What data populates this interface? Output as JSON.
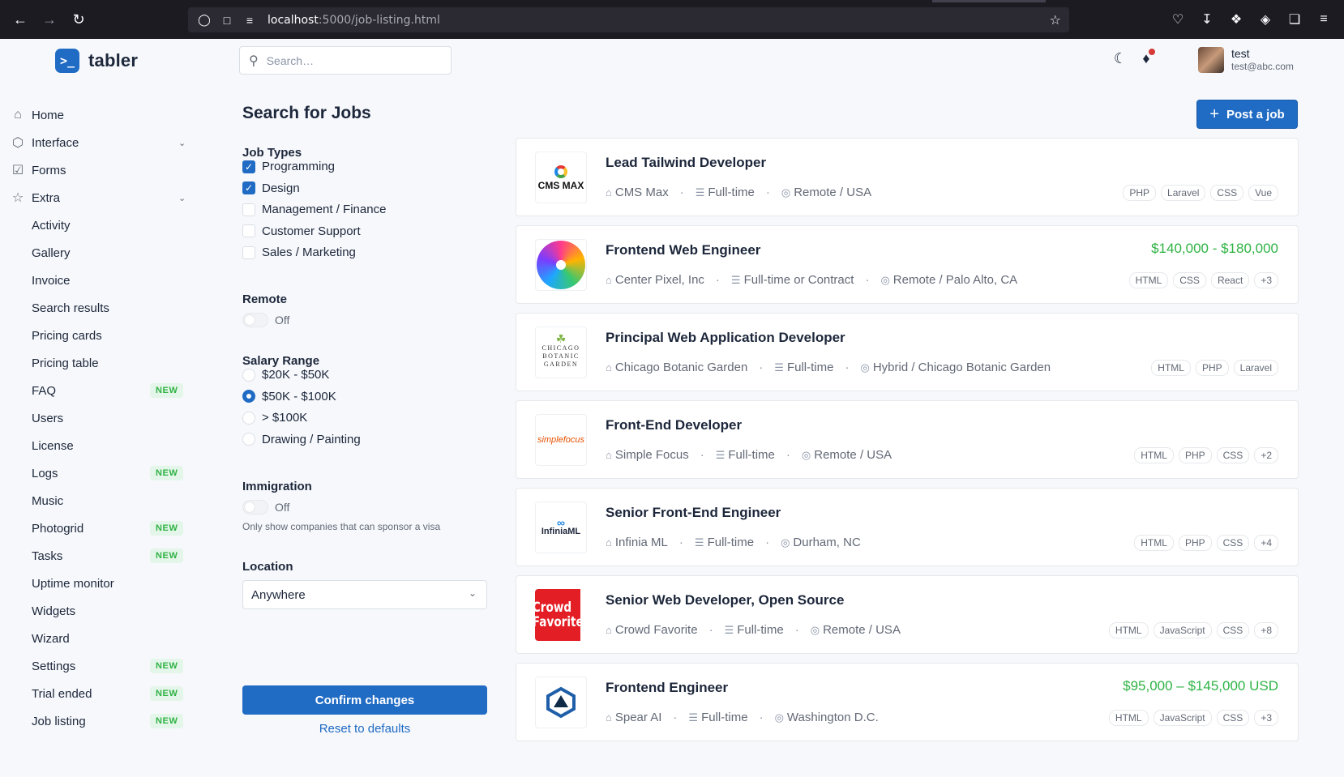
{
  "browser": {
    "url_host": "localhost",
    "url_path": ":5000/job-listing.html"
  },
  "brand": {
    "logo_glyph": ">_",
    "name": "tabler"
  },
  "sidebar": {
    "items": [
      {
        "label": "Home",
        "icon": "home-icon"
      },
      {
        "label": "Interface",
        "icon": "package-icon",
        "chevron": true
      },
      {
        "label": "Forms",
        "icon": "checkbox-icon"
      },
      {
        "label": "Extra",
        "icon": "star-icon",
        "chevron": true
      },
      {
        "label": "Activity"
      },
      {
        "label": "Gallery"
      },
      {
        "label": "Invoice"
      },
      {
        "label": "Search results"
      },
      {
        "label": "Pricing cards"
      },
      {
        "label": "Pricing table"
      },
      {
        "label": "FAQ",
        "badge": "NEW"
      },
      {
        "label": "Users"
      },
      {
        "label": "License"
      },
      {
        "label": "Logs",
        "badge": "NEW"
      },
      {
        "label": "Music"
      },
      {
        "label": "Photogrid",
        "badge": "NEW"
      },
      {
        "label": "Tasks",
        "badge": "NEW"
      },
      {
        "label": "Uptime monitor"
      },
      {
        "label": "Widgets"
      },
      {
        "label": "Wizard"
      },
      {
        "label": "Settings",
        "badge": "NEW"
      },
      {
        "label": "Trial ended",
        "badge": "NEW"
      },
      {
        "label": "Job listing",
        "badge": "NEW"
      }
    ]
  },
  "topbar": {
    "search_placeholder": "Search…",
    "user_name": "test",
    "user_email": "test@abc.com"
  },
  "page": {
    "title": "Search for Jobs",
    "post_button": "Post a job"
  },
  "filters": {
    "job_types": {
      "title": "Job Types",
      "options": [
        {
          "label": "Programming",
          "checked": true
        },
        {
          "label": "Design",
          "checked": true
        },
        {
          "label": "Management / Finance",
          "checked": false
        },
        {
          "label": "Customer Support",
          "checked": false
        },
        {
          "label": "Sales / Marketing",
          "checked": false
        }
      ]
    },
    "remote": {
      "title": "Remote",
      "state": "Off"
    },
    "salary": {
      "title": "Salary Range",
      "options": [
        {
          "label": "$20K - $50K",
          "selected": false
        },
        {
          "label": "$50K - $100K",
          "selected": true
        },
        {
          "label": "> $100K",
          "selected": false
        },
        {
          "label": "Drawing / Painting",
          "selected": false
        }
      ]
    },
    "immigration": {
      "title": "Immigration",
      "state": "Off",
      "hint": "Only show companies that can sponsor a visa"
    },
    "location": {
      "title": "Location",
      "value": "Anywhere"
    },
    "confirm": "Confirm changes",
    "reset": "Reset to defaults"
  },
  "jobs": [
    {
      "title": "Lead Tailwind Developer",
      "company": "CMS Max",
      "type": "Full-time",
      "location": "Remote / USA",
      "salary": "",
      "tags": [
        "PHP",
        "Laravel",
        "CSS",
        "Vue"
      ],
      "logo_text": "CMS MAX"
    },
    {
      "title": "Frontend Web Engineer",
      "company": "Center Pixel, Inc",
      "type": "Full-time or Contract",
      "location": "Remote / Palo Alto, CA",
      "salary": "$140,000 - $180,000",
      "tags": [
        "HTML",
        "CSS",
        "React",
        "+3"
      ]
    },
    {
      "title": "Principal Web Application Developer",
      "company": "Chicago Botanic Garden",
      "type": "Full-time",
      "location": "Hybrid / Chicago Botanic Garden",
      "salary": "",
      "tags": [
        "HTML",
        "PHP",
        "Laravel"
      ],
      "logo_lines": [
        "CHICAGO",
        "BOTANIC",
        "GARDEN"
      ]
    },
    {
      "title": "Front-End Developer",
      "company": "Simple Focus",
      "type": "Full-time",
      "location": "Remote / USA",
      "salary": "",
      "tags": [
        "HTML",
        "PHP",
        "CSS",
        "+2"
      ],
      "logo_text": "simplefocus"
    },
    {
      "title": "Senior Front-End Engineer",
      "company": "Infinia ML",
      "type": "Full-time",
      "location": "Durham, NC",
      "salary": "",
      "tags": [
        "HTML",
        "PHP",
        "CSS",
        "+4"
      ],
      "logo_text": "InfiniaML"
    },
    {
      "title": "Senior Web Developer, Open Source",
      "company": "Crowd Favorite",
      "type": "Full-time",
      "location": "Remote / USA",
      "salary": "",
      "tags": [
        "HTML",
        "JavaScript",
        "CSS",
        "+8"
      ],
      "logo_lines": [
        "Crowd",
        "Favorite"
      ]
    },
    {
      "title": "Frontend Engineer",
      "company": "Spear AI",
      "type": "Full-time",
      "location": "Washington D.C.",
      "salary": "$95,000 – $145,000 USD",
      "tags": [
        "HTML",
        "JavaScript",
        "CSS",
        "+3"
      ]
    }
  ],
  "colors": {
    "primary": "#206bc4",
    "success": "#2fb344",
    "danger": "#d63939"
  }
}
